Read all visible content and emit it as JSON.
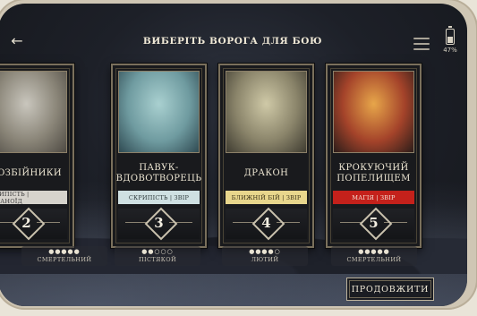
{
  "header": {
    "title": "ВИБЕРІТЬ ВОРОГА ДЛЯ БОЮ",
    "back_icon": "arrow-left-icon",
    "menu_icon": "hamburger-menu-icon",
    "battery_label": "47%",
    "battery_level_percent": 47
  },
  "enemies": [
    {
      "name": "РОЗБІЙНИКИ",
      "tags": "СКРИПІСТЬ | ГУМАНОЇД",
      "tag_bg": "#d6d3cc",
      "tag_color": "#3a3a3a",
      "level": "2",
      "difficulty_dots": "●●●●●",
      "difficulty": "СМЕРТЕЛЬНИЙ",
      "art_colors": [
        "#c9c6bd",
        "#8a8578",
        "#4e4a43"
      ]
    },
    {
      "name": "ПАВУК-ВДОВОТВОРЕЦЬ",
      "tags": "СКРИПІСТЬ | ЗВІР",
      "tag_bg": "#cfe0e2",
      "tag_color": "#2f3b3d",
      "level": "3",
      "difficulty_dots": "●●○○○",
      "difficulty": "ПІСТЯКОЙ",
      "art_colors": [
        "#a9d0d0",
        "#6f9ba0",
        "#2f4a52"
      ]
    },
    {
      "name": "ДРАКОН",
      "tags": "БЛИЖНІЙ БІЙ | ЗВІР",
      "tag_bg": "#e8d68c",
      "tag_color": "#3a3218",
      "level": "4",
      "difficulty_dots": "●●●●○",
      "difficulty": "ЛЮТИЙ",
      "art_colors": [
        "#cfc9a7",
        "#8a846a",
        "#3f3c31"
      ]
    },
    {
      "name": "КРОКУЮЧИЙ ПОПЕЛИЩЕМ",
      "tags": "МАГІЯ | ЗВІР",
      "tag_bg": "#c4211b",
      "tag_color": "#f6e7dc",
      "level": "5",
      "difficulty_dots": "●●●●●",
      "difficulty": "СМЕРТЕЛЬНИЙ",
      "art_colors": [
        "#e7a64a",
        "#a4432a",
        "#2b1d1a"
      ]
    }
  ],
  "continue_label": "ПРОДОВЖИТИ"
}
